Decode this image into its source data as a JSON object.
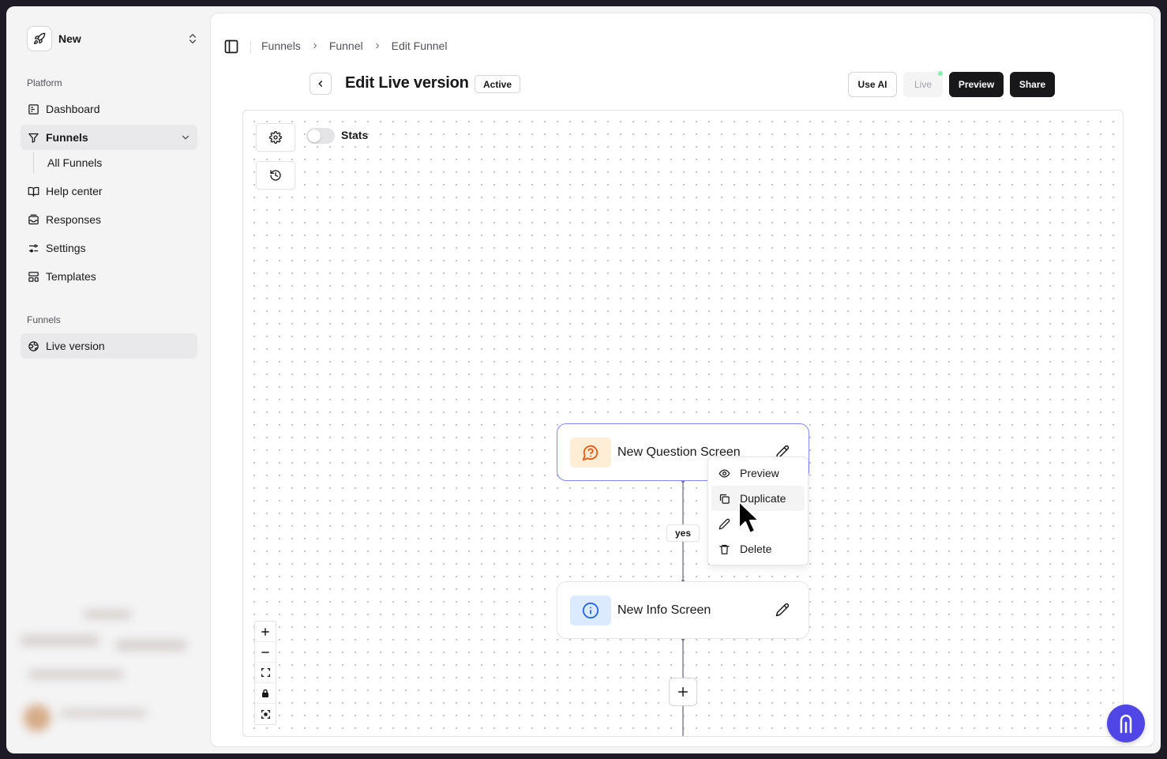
{
  "workspace": {
    "name": "New"
  },
  "sidebar": {
    "platform_label": "Platform",
    "items": [
      {
        "label": "Dashboard",
        "icon": "dashboard-icon"
      },
      {
        "label": "Funnels",
        "icon": "filter-icon"
      },
      {
        "label": "Help center",
        "icon": "book-icon"
      },
      {
        "label": "Responses",
        "icon": "inbox-icon"
      },
      {
        "label": "Settings",
        "icon": "sliders-icon"
      },
      {
        "label": "Templates",
        "icon": "layout-icon"
      }
    ],
    "sub_items": [
      {
        "label": "All Funnels"
      }
    ],
    "funnels_label": "Funnels",
    "funnel_items": [
      {
        "label": "Live version",
        "icon": "globe-icon"
      }
    ]
  },
  "breadcrumb": [
    "Funnels",
    "Funnel",
    "Edit Funnel"
  ],
  "header": {
    "title": "Edit Live version",
    "status": "Active",
    "use_ai": "Use AI",
    "live": "Live",
    "preview": "Preview",
    "share": "Share"
  },
  "canvas": {
    "stats_label": "Stats",
    "stats_enabled": false,
    "nodes": [
      {
        "title": "New Question Screen",
        "icon": "question-bubble-icon",
        "accent": "#ea580c",
        "icon_bg": "#ffedd5"
      },
      {
        "title": "New Info Screen",
        "icon": "info-icon",
        "accent": "#2563eb",
        "icon_bg": "#dbeafe"
      }
    ],
    "edge_label": "yes",
    "context_menu": [
      {
        "label": "Preview",
        "icon": "eye-icon"
      },
      {
        "label": "Duplicate",
        "icon": "copy-icon"
      },
      {
        "label": "",
        "icon": "pencil-icon"
      },
      {
        "label": "Delete",
        "icon": "trash-icon"
      }
    ]
  },
  "colors": {
    "accent": "#4f46e5",
    "selected_border": "#818cf8"
  }
}
